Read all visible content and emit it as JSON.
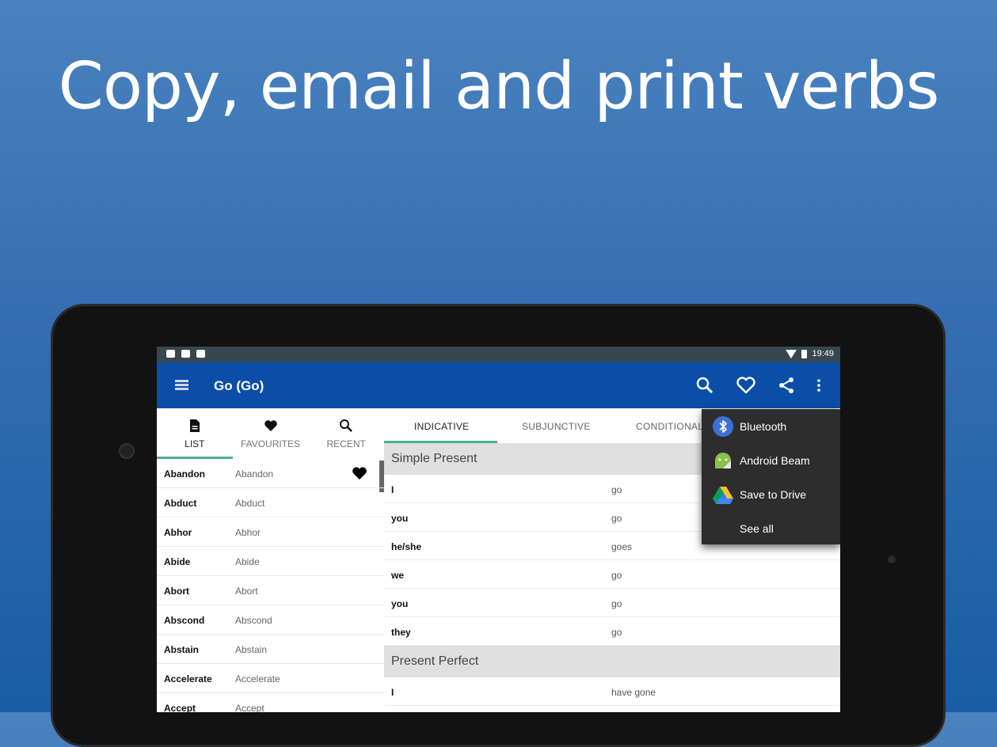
{
  "headline": "Copy, email and print verbs",
  "status_bar": {
    "time": "19:49"
  },
  "app_bar": {
    "title": "Go (Go)",
    "icons": [
      "menu-icon",
      "search-icon",
      "heart-icon",
      "share-icon",
      "overflow-icon"
    ]
  },
  "left_tabs": [
    {
      "label": "LIST",
      "icon": "document-icon",
      "active": true
    },
    {
      "label": "FAVOURITES",
      "icon": "heart-icon",
      "active": false
    },
    {
      "label": "RECENT",
      "icon": "search-icon",
      "active": false
    }
  ],
  "verb_list": [
    {
      "verb": "Abandon",
      "translation": "Abandon",
      "favourite": true
    },
    {
      "verb": "Abduct",
      "translation": "Abduct",
      "favourite": false
    },
    {
      "verb": "Abhor",
      "translation": "Abhor",
      "favourite": false
    },
    {
      "verb": "Abide",
      "translation": "Abide",
      "favourite": false
    },
    {
      "verb": "Abort",
      "translation": "Abort",
      "favourite": false
    },
    {
      "verb": "Abscond",
      "translation": "Abscond",
      "favourite": false
    },
    {
      "verb": "Abstain",
      "translation": "Abstain",
      "favourite": false
    },
    {
      "verb": "Accelerate",
      "translation": "Accelerate",
      "favourite": false
    },
    {
      "verb": "Accept",
      "translation": "Accept",
      "favourite": false
    }
  ],
  "mood_tabs": [
    {
      "label": "INDICATIVE",
      "active": true
    },
    {
      "label": "SUBJUNCTIVE",
      "active": false
    },
    {
      "label": "CONDITIONAL",
      "active": false
    }
  ],
  "sections": [
    {
      "title": "Simple Present",
      "rows": [
        {
          "pronoun": "I",
          "form": "go"
        },
        {
          "pronoun": "you",
          "form": "go"
        },
        {
          "pronoun": "he/she",
          "form": "goes"
        },
        {
          "pronoun": "we",
          "form": "go"
        },
        {
          "pronoun": "you",
          "form": "go"
        },
        {
          "pronoun": "they",
          "form": "go"
        }
      ]
    },
    {
      "title": "Present Perfect",
      "rows": [
        {
          "pronoun": "I",
          "form": "have gone"
        }
      ]
    }
  ],
  "share_menu": [
    {
      "label": "Bluetooth",
      "icon": "bluetooth-icon"
    },
    {
      "label": "Android Beam",
      "icon": "android-icon"
    },
    {
      "label": "Save to Drive",
      "icon": "drive-icon"
    },
    {
      "label": "See all",
      "icon": ""
    }
  ],
  "colors": {
    "app_bar": "#0a4ea8",
    "accent": "#4caf9a",
    "status_bar": "#37474f"
  }
}
